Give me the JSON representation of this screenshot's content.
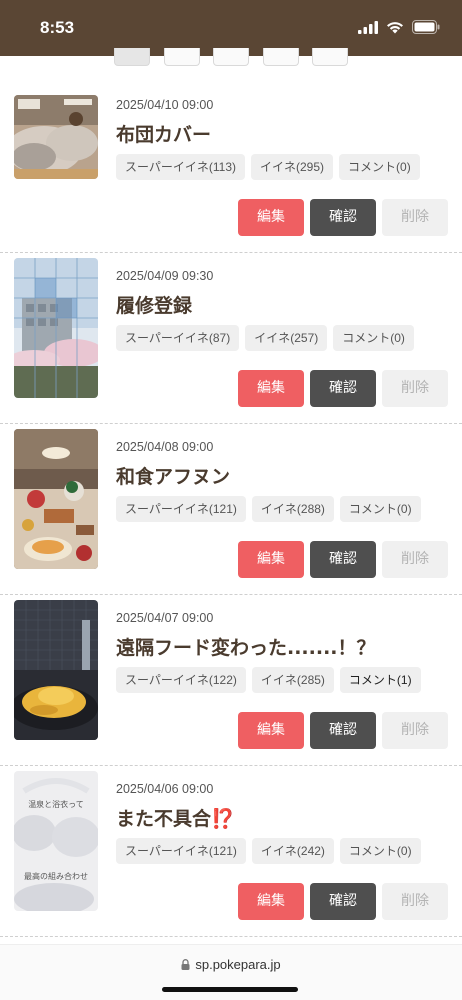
{
  "status": {
    "time": "8:53"
  },
  "buttons": {
    "edit": "編集",
    "confirm": "確認",
    "delete": "削除"
  },
  "posts": [
    {
      "date": "2025/04/10 09:00",
      "title": "布団カバー",
      "super_like": "スーパーイイネ(113)",
      "like": "イイネ(295)",
      "comment": "コメント(0)"
    },
    {
      "date": "2025/04/09 09:30",
      "title": "履修登録",
      "super_like": "スーパーイイネ(87)",
      "like": "イイネ(257)",
      "comment": "コメント(0)"
    },
    {
      "date": "2025/04/08 09:00",
      "title": "和食アフヌン",
      "super_like": "スーパーイイネ(121)",
      "like": "イイネ(288)",
      "comment": "コメント(0)"
    },
    {
      "date": "2025/04/07 09:00",
      "title": "遠隔フード変わった.......！？",
      "super_like": "スーパーイイネ(122)",
      "like": "イイネ(285)",
      "comment": "コメント(1)"
    },
    {
      "date": "2025/04/06 09:00",
      "title": "また不具合⁉️",
      "super_like": "スーパーイイネ(121)",
      "like": "イイネ(242)",
      "comment": "コメント(0)",
      "thumb_text_top": "温泉と浴衣って",
      "thumb_text_bottom": "最高の組み合わせ"
    }
  ],
  "url_bar": {
    "domain": "sp.pokepara.jp"
  }
}
